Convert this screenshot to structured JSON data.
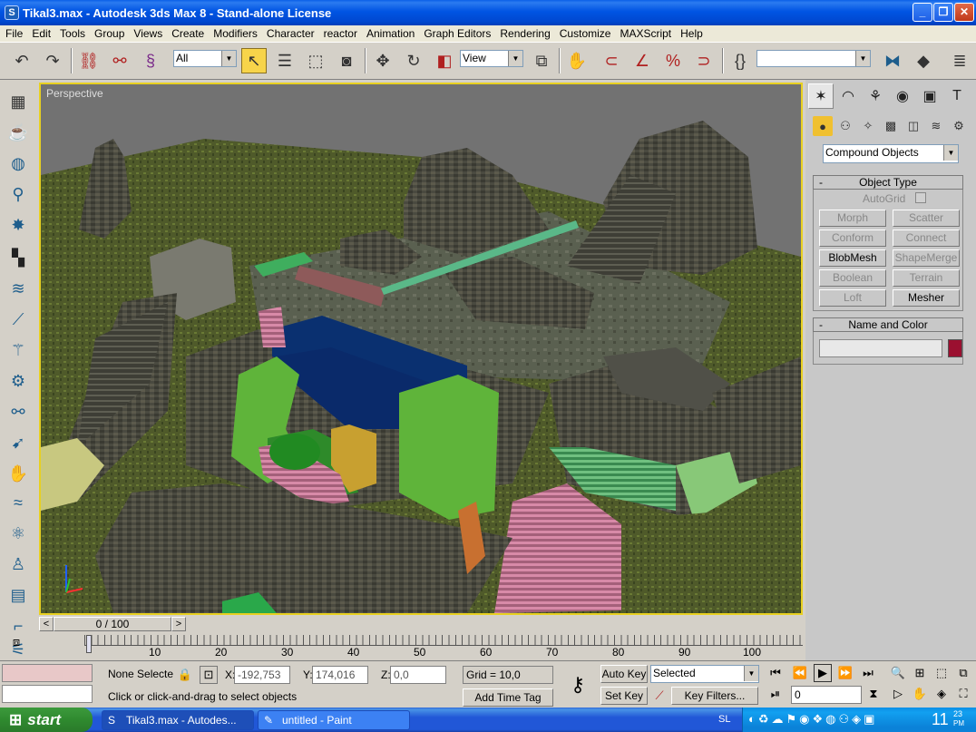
{
  "window": {
    "title": "Tikal3.max - Autodesk 3ds Max 8  - Stand-alone License",
    "controls": {
      "minimize": "_",
      "maximize": "❐",
      "close": "✕"
    }
  },
  "menu": [
    "File",
    "Edit",
    "Tools",
    "Group",
    "Views",
    "Create",
    "Modifiers",
    "Character",
    "reactor",
    "Animation",
    "Graph Editors",
    "Rendering",
    "Customize",
    "MAXScript",
    "Help"
  ],
  "toolbar": {
    "selection_filter": "All",
    "reference_coord": "View",
    "named_selection": ""
  },
  "viewport": {
    "label": "Perspective"
  },
  "command_panel": {
    "category_dropdown": "Compound Objects",
    "object_type_header": "Object Type",
    "autogrid_label": "AutoGrid",
    "buttons": [
      "Morph",
      "Scatter",
      "Conform",
      "Connect",
      "BlobMesh",
      "ShapeMerge",
      "Boolean",
      "Terrain",
      "Loft",
      "Mesher"
    ],
    "enabled_buttons": [
      "BlobMesh",
      "Mesher"
    ],
    "name_color_header": "Name and Color",
    "object_name": "",
    "object_color": "#9b1030"
  },
  "timeline": {
    "frame_display": "0 / 100",
    "ticks": [
      "10",
      "20",
      "30",
      "40",
      "50",
      "60",
      "70",
      "80",
      "90",
      "100"
    ]
  },
  "status": {
    "selection": "None Selecte",
    "x_label": "X:",
    "x_value": "-192,753",
    "y_label": "Y:",
    "y_value": "174,016",
    "z_label": "Z:",
    "z_value": "0,0",
    "grid": "Grid = 10,0",
    "prompt": "Click or click-and-drag to select objects",
    "add_time_tag": "Add Time Tag",
    "auto_key": "Auto Key",
    "set_key": "Set Key",
    "key_mode": "Selected",
    "key_filters": "Key Filters...",
    "current_frame": "0"
  },
  "taskbar": {
    "start": "start",
    "tasks": [
      {
        "label": "Tikal3.max - Autodes..."
      },
      {
        "label": "untitled - Paint"
      }
    ],
    "language": "SL",
    "clock": "11",
    "clock_small": "23",
    "clock_ampm": "PM"
  }
}
